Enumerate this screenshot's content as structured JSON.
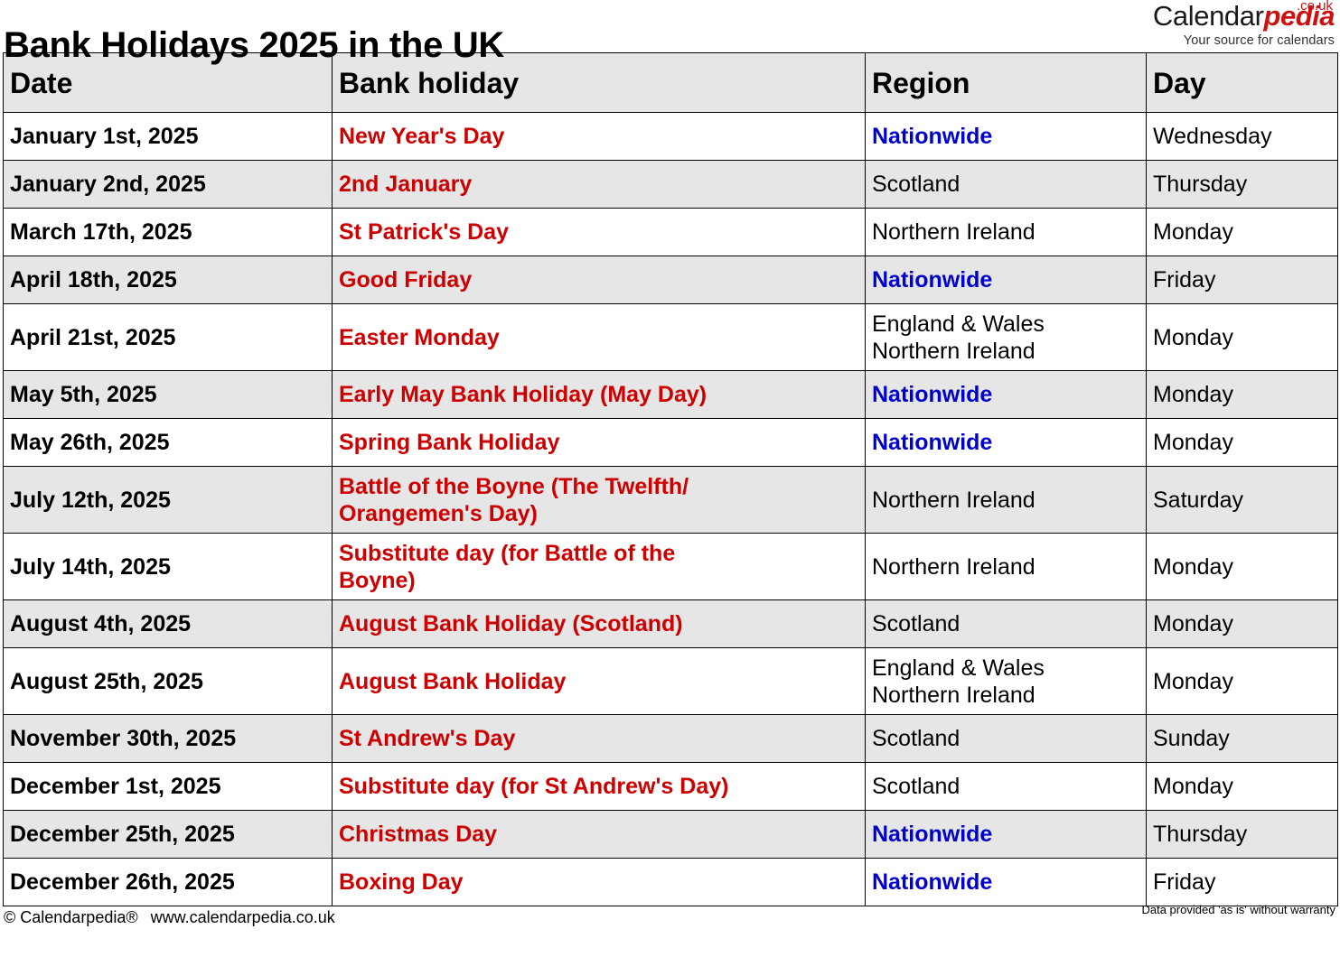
{
  "header": {
    "title": "Bank Holidays 2025 in the UK",
    "logo": {
      "name_part1": "Calendar",
      "name_part2": "pedia",
      "tld": ".co.uk",
      "tagline": "Your source for calendars"
    }
  },
  "table": {
    "columns": [
      "Date",
      "Bank holiday",
      "Region",
      "Day"
    ],
    "rows": [
      {
        "date": "January 1st, 2025",
        "holiday_line1": "New Year's Day",
        "holiday_line2": "",
        "region_line1": "Nationwide",
        "region_line2": "",
        "region_nationwide": true,
        "day": "Wednesday",
        "shaded": false,
        "tall": false
      },
      {
        "date": "January 2nd, 2025",
        "holiday_line1": "2nd January",
        "holiday_line2": "",
        "region_line1": "Scotland",
        "region_line2": "",
        "region_nationwide": false,
        "day": "Thursday",
        "shaded": true,
        "tall": false
      },
      {
        "date": "March 17th, 2025",
        "holiday_line1": "St Patrick's Day",
        "holiday_line2": "",
        "region_line1": "Northern Ireland",
        "region_line2": "",
        "region_nationwide": false,
        "day": "Monday",
        "shaded": false,
        "tall": false
      },
      {
        "date": "April 18th, 2025",
        "holiday_line1": "Good Friday",
        "holiday_line2": "",
        "region_line1": "Nationwide",
        "region_line2": "",
        "region_nationwide": true,
        "day": "Friday",
        "shaded": true,
        "tall": false
      },
      {
        "date": "April 21st, 2025",
        "holiday_line1": "Easter Monday",
        "holiday_line2": "",
        "region_line1": "England & Wales",
        "region_line2": "Northern Ireland",
        "region_nationwide": false,
        "day": "Monday",
        "shaded": false,
        "tall": true
      },
      {
        "date": "May 5th, 2025",
        "holiday_line1": "Early May Bank Holiday (May Day)",
        "holiday_line2": "",
        "region_line1": "Nationwide",
        "region_line2": "",
        "region_nationwide": true,
        "day": "Monday",
        "shaded": true,
        "tall": false
      },
      {
        "date": "May 26th, 2025",
        "holiday_line1": "Spring Bank Holiday",
        "holiday_line2": "",
        "region_line1": "Nationwide",
        "region_line2": "",
        "region_nationwide": true,
        "day": "Monday",
        "shaded": false,
        "tall": false
      },
      {
        "date": "July 12th, 2025",
        "holiday_line1": "Battle of the Boyne (The Twelfth/",
        "holiday_line2": "Orangemen's Day)",
        "region_line1": "Northern Ireland",
        "region_line2": "",
        "region_nationwide": false,
        "day": "Saturday",
        "shaded": true,
        "tall": true
      },
      {
        "date": "July 14th, 2025",
        "holiday_line1": "Substitute day (for Battle of the",
        "holiday_line2": "Boyne)",
        "region_line1": "Northern Ireland",
        "region_line2": "",
        "region_nationwide": false,
        "day": "Monday",
        "shaded": false,
        "tall": true
      },
      {
        "date": "August 4th, 2025",
        "holiday_line1": "August Bank Holiday (Scotland)",
        "holiday_line2": "",
        "region_line1": "Scotland",
        "region_line2": "",
        "region_nationwide": false,
        "day": "Monday",
        "shaded": true,
        "tall": false
      },
      {
        "date": "August 25th, 2025",
        "holiday_line1": "August Bank Holiday",
        "holiday_line2": "",
        "region_line1": "England & Wales",
        "region_line2": "Northern Ireland",
        "region_nationwide": false,
        "day": "Monday",
        "shaded": false,
        "tall": true
      },
      {
        "date": "November 30th, 2025",
        "holiday_line1": "St Andrew's Day",
        "holiday_line2": "",
        "region_line1": "Scotland",
        "region_line2": "",
        "region_nationwide": false,
        "day": "Sunday",
        "shaded": true,
        "tall": false
      },
      {
        "date": "December 1st, 2025",
        "holiday_line1": "Substitute day (for St Andrew's Day)",
        "holiday_line2": "",
        "region_line1": "Scotland",
        "region_line2": "",
        "region_nationwide": false,
        "day": "Monday",
        "shaded": false,
        "tall": false
      },
      {
        "date": "December 25th, 2025",
        "holiday_line1": "Christmas Day",
        "holiday_line2": "",
        "region_line1": "Nationwide",
        "region_line2": "",
        "region_nationwide": true,
        "day": "Thursday",
        "shaded": true,
        "tall": false
      },
      {
        "date": "December 26th, 2025",
        "holiday_line1": "Boxing Day",
        "holiday_line2": "",
        "region_line1": "Nationwide",
        "region_line2": "",
        "region_nationwide": true,
        "day": "Friday",
        "shaded": false,
        "tall": false
      }
    ]
  },
  "footer": {
    "copyright": "© Calendarpedia®",
    "website": "www.calendarpedia.co.uk",
    "disclaimer": "Data provided 'as is' without warranty"
  },
  "colors": {
    "holiday_red": "#cc0000",
    "nationwide_blue": "#0000cc",
    "shaded_row": "#e6e6e6",
    "logo_red": "#cc1111"
  }
}
